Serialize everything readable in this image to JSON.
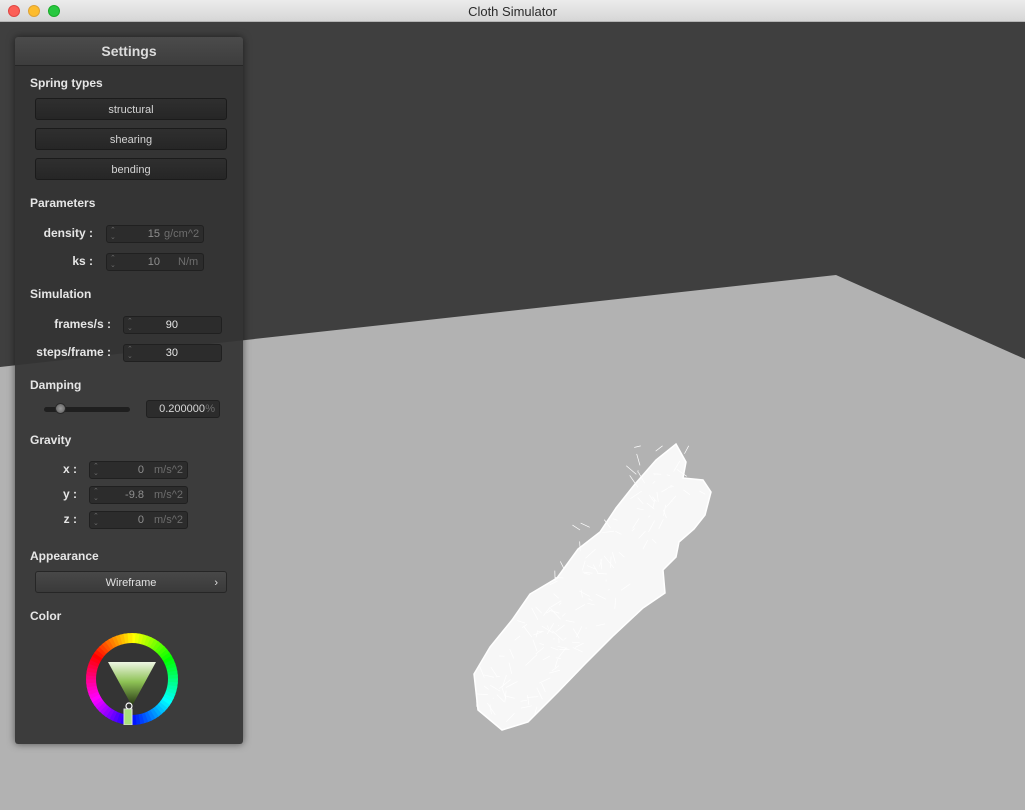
{
  "window": {
    "title": "Cloth Simulator"
  },
  "settings": {
    "title": "Settings",
    "spring_types": {
      "label": "Spring types",
      "buttons": [
        "structural",
        "shearing",
        "bending"
      ]
    },
    "parameters": {
      "label": "Parameters",
      "density": {
        "label": "density :",
        "value": "15",
        "unit": "g/cm^2"
      },
      "ks": {
        "label": "ks :",
        "value": "10",
        "unit": "N/m"
      }
    },
    "simulation": {
      "label": "Simulation",
      "fps": {
        "label": "frames/s :",
        "value": "90"
      },
      "steps": {
        "label": "steps/frame :",
        "value": "30"
      }
    },
    "damping": {
      "label": "Damping",
      "value": "0.200000",
      "unit": "%",
      "slider_fraction": 0.2
    },
    "gravity": {
      "label": "Gravity",
      "x": {
        "label": "x :",
        "value": "0",
        "unit": "m/s^2"
      },
      "y": {
        "label": "y :",
        "value": "-9.8",
        "unit": "m/s^2"
      },
      "z": {
        "label": "z :",
        "value": "0",
        "unit": "m/s^2"
      }
    },
    "appearance": {
      "label": "Appearance",
      "value": "Wireframe",
      "chevron": "›"
    },
    "color": {
      "label": "Color",
      "selected": "#8ec255"
    }
  },
  "scene": {
    "floor_color": "#b2b2b2",
    "background_color": "#3f3f3f",
    "mesh_color": "#ffffff",
    "render_mode": "wireframe"
  }
}
